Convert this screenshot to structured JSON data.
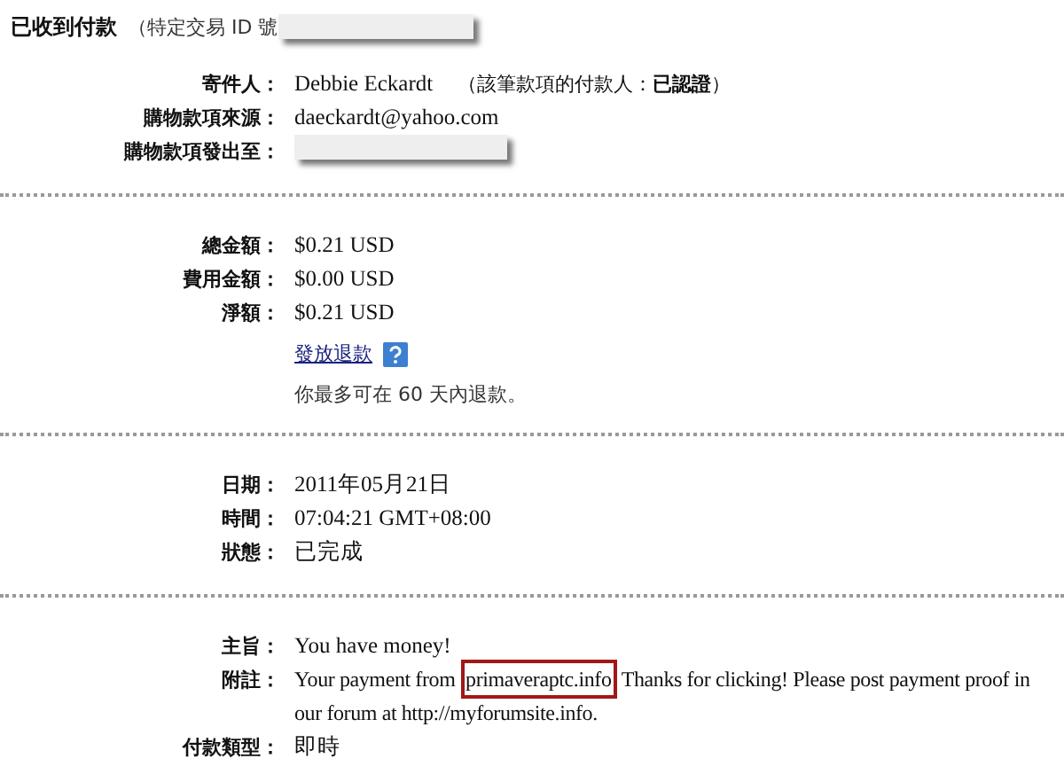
{
  "header": {
    "title": "已收到付款",
    "subtitle": "（特定交易 ID 號",
    "redacted": true
  },
  "sections": [
    {
      "rows": [
        {
          "label": "寄件人：",
          "value": "Debbie Eckardt",
          "extra": "（該筆款項的付款人：**已認證**）"
        },
        {
          "label": "購物款項來源：",
          "value": "daeckardt@yahoo.com"
        },
        {
          "label": "購物款項發出至：",
          "redacted": true
        }
      ]
    },
    {
      "rows": [
        {
          "label": "總金額：",
          "value": "$0.21 USD"
        },
        {
          "label": "費用金額：",
          "value": "$0.00 USD"
        },
        {
          "label": "淨額：",
          "value": "$0.21 USD"
        }
      ],
      "refund_link": "發放退款",
      "refund_note": "你最多可在 60 天內退款。"
    },
    {
      "rows": [
        {
          "label": "日期：",
          "value": "2011年05月21日"
        },
        {
          "label": "時間：",
          "value": "07:04:21 GMT+08:00"
        },
        {
          "label": "狀態：",
          "value": "已完成"
        }
      ]
    },
    {
      "rows": [
        {
          "label": "主旨：",
          "value": "You have money!"
        },
        {
          "label": "附註：",
          "note": {
            "before": "Your payment from ",
            "boxed": "primaveraptc.info",
            "after": " Thanks for clicking! Please post payment proof in our forum at http://myforumsite.info."
          }
        },
        {
          "label": "付款類型：",
          "value": "即時"
        }
      ]
    }
  ]
}
